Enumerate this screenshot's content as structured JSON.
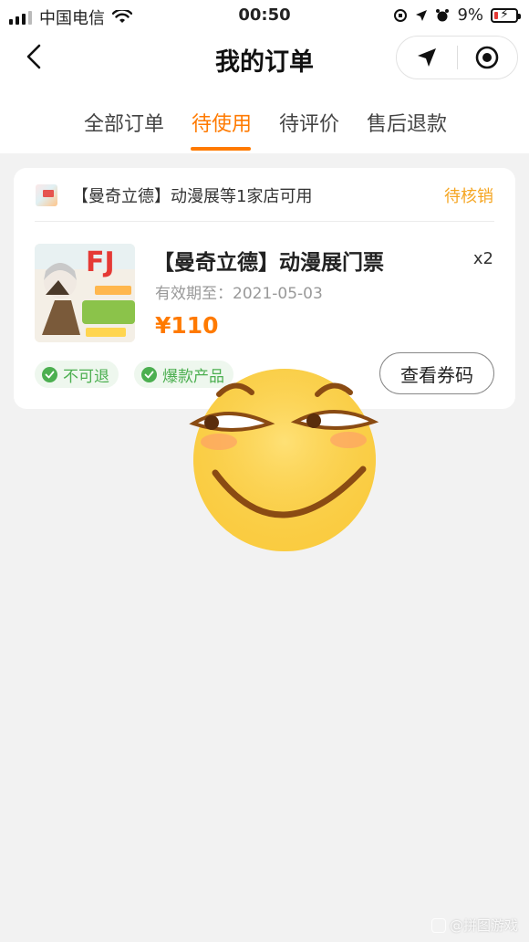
{
  "status_bar": {
    "carrier": "中国电信",
    "time": "00:50",
    "battery_percent": "9%"
  },
  "nav": {
    "title": "我的订单"
  },
  "tabs": [
    {
      "label": "全部订单",
      "active": false
    },
    {
      "label": "待使用",
      "active": true
    },
    {
      "label": "待评价",
      "active": false
    },
    {
      "label": "售后退款",
      "active": false
    }
  ],
  "order": {
    "store_name": "【曼奇立德】动漫展等1家店可用",
    "status": "待核销",
    "product_name": "【曼奇立德】动漫展门票",
    "quantity": "x2",
    "valid_label": "有效期至：2021-05-03",
    "price": "¥110",
    "tags": [
      "不可退",
      "爆款产品"
    ],
    "view_code_label": "查看券码"
  },
  "colors": {
    "accent": "#ff7a00",
    "status": "#f5a623",
    "tag_green": "#4caf50",
    "background": "#f2f2f2"
  },
  "watermark": {
    "text": "@拼图游戏"
  }
}
